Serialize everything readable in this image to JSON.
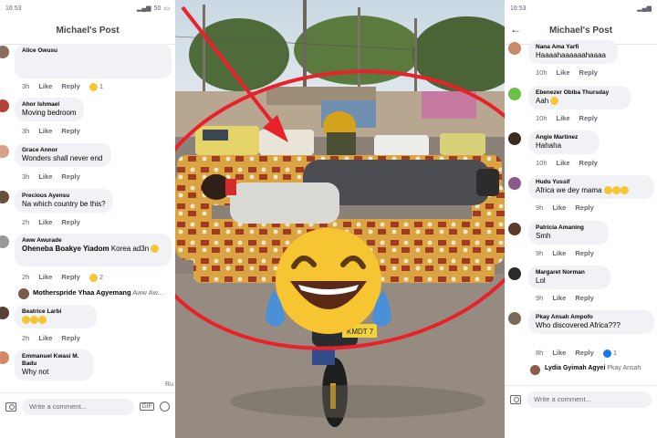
{
  "left": {
    "status_time": "16:53",
    "status_battery": "50",
    "title": "Michael's Post",
    "comments": [
      {
        "name": "Alice Owusu",
        "text": "",
        "time": "3h",
        "like": "Like",
        "reply": "Reply",
        "reactions": "1"
      },
      {
        "name": "Ahor Ishmael",
        "text": "Moving bedroom",
        "time": "3h",
        "like": "Like",
        "reply": "Reply"
      },
      {
        "name": "Grace Annor",
        "text": "Wonders shall never end",
        "time": "3h",
        "like": "Like",
        "reply": "Reply"
      },
      {
        "name": "Precious Ayensu",
        "text": "Na which country be this?",
        "time": "2h",
        "like": "Like",
        "reply": "Reply"
      },
      {
        "name": "Aww Awurade",
        "name2": "Oheneba Boakye Yiadom",
        "text": "Korea ad3n",
        "time": "2h",
        "like": "Like",
        "reply": "Reply",
        "reactions": "2"
      },
      {
        "name": "Motherspride Yhaa Agyemang",
        "text": "Aww Aw..."
      },
      {
        "name": "Beatrice Larbi",
        "text": "",
        "time": "2h",
        "like": "Like",
        "reply": "Reply"
      },
      {
        "name": "Emmanuel Kwasi M. Badu",
        "text": "Why not",
        "time": "",
        "like": "",
        "reply": ""
      }
    ],
    "composer_placeholder": "Write a comment...",
    "cutoff_label": "Ru"
  },
  "right": {
    "title": "Michael's Post",
    "comments": [
      {
        "name": "Nana Ama Yarfi",
        "text": "Haaaahaaaaaahaaaa",
        "time": "10h",
        "like": "Like",
        "reply": "Reply"
      },
      {
        "name": "Ebenezer Obiba Thursday",
        "text": "Aah",
        "time": "10h",
        "like": "Like",
        "reply": "Reply"
      },
      {
        "name": "Angie Martinez",
        "text": "Hahaha",
        "time": "10h",
        "like": "Like",
        "reply": "Reply"
      },
      {
        "name": "Hudu Yussif",
        "text": "Africa we dey mama",
        "time": "9h",
        "like": "Like",
        "reply": "Reply"
      },
      {
        "name": "Patricia Amaning",
        "text": "Smh",
        "time": "9h",
        "like": "Like",
        "reply": "Reply"
      },
      {
        "name": "Margaret Norman",
        "text": "Lol",
        "time": "9h",
        "like": "Like",
        "reply": "Reply"
      },
      {
        "name": "Pkay Ansah Ampofo",
        "text": "Who discovered Africa???",
        "time": "8h",
        "like": "Like",
        "reply": "Reply",
        "reactions": "1"
      },
      {
        "name": "Lydia Gyimah Agyei",
        "text": "Pkay Ansah"
      }
    ],
    "composer_placeholder": "Write a comment..."
  },
  "photo": {
    "plate": "KMDT 7"
  },
  "colors": {
    "annotation": "#e8212b",
    "emoji": "#f7c531",
    "bubble": "#f0f2f5"
  }
}
